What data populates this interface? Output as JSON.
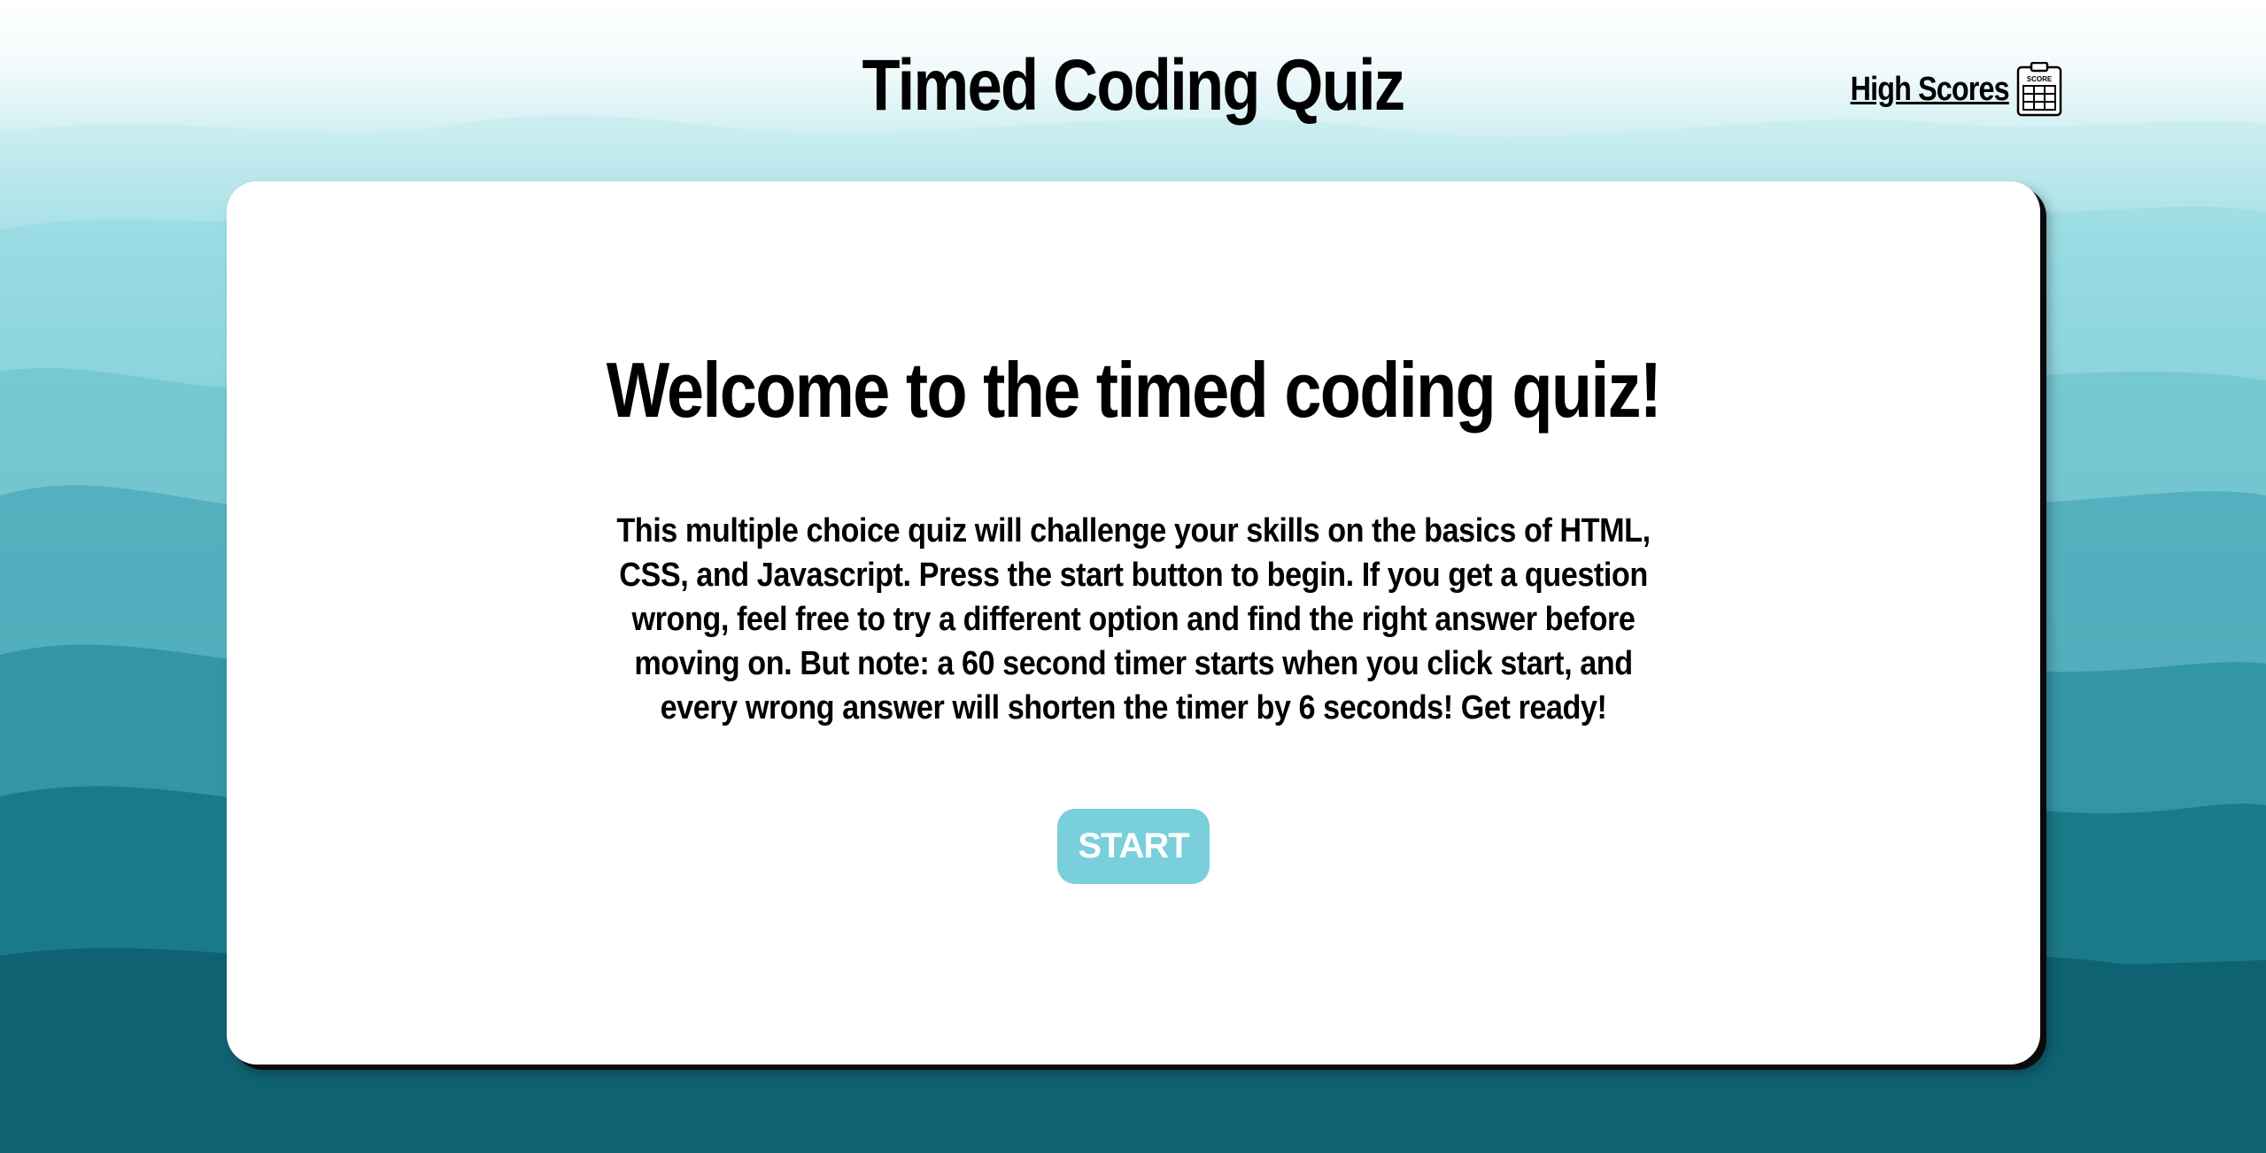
{
  "header": {
    "title": "Timed Coding Quiz",
    "high_scores_label": "High Scores",
    "high_scores_icon": "score-clipboard-icon",
    "icon_text": "SCORE"
  },
  "card": {
    "heading": "Welcome to the timed coding quiz!",
    "description": "This multiple choice quiz will challenge your skills on the basics of HTML, CSS, and Javascript. Press the start button to begin. If you get a question wrong, feel free to try a different option and find the right answer before moving on. But note: a 60 second timer starts when you click start, and every wrong answer will shorten the timer by 6 seconds! Get ready!",
    "start_label": "START"
  },
  "colors": {
    "accent": "#79cfdc",
    "card_background": "#ffffff",
    "text": "#000000"
  }
}
